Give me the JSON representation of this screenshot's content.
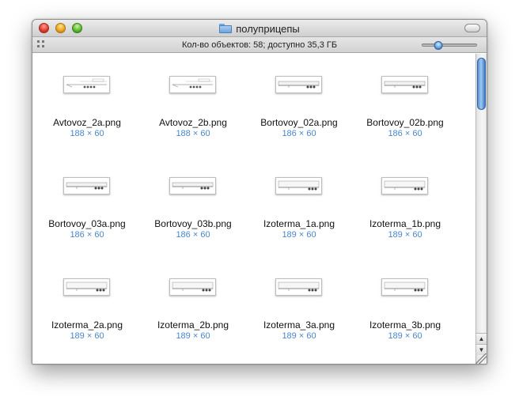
{
  "window": {
    "title": "полуприцепы",
    "folder_icon": "folder-icon"
  },
  "statusbar": {
    "text": "Кол-во объектов: 58; доступно 35,3 ГБ",
    "icon_size_slider_value": 0.3
  },
  "files": [
    {
      "name": "Avtovoz_2a.png",
      "dimensions": "188 × 60",
      "thumb": "car-carrier"
    },
    {
      "name": "Avtovoz_2b.png",
      "dimensions": "188 × 60",
      "thumb": "car-carrier"
    },
    {
      "name": "Bortovoy_02a.png",
      "dimensions": "186 × 60",
      "thumb": "flatbed"
    },
    {
      "name": "Bortovoy_02b.png",
      "dimensions": "186 × 60",
      "thumb": "flatbed"
    },
    {
      "name": "Bortovoy_03a.png",
      "dimensions": "186 × 60",
      "thumb": "flatbed"
    },
    {
      "name": "Bortovoy_03b.png",
      "dimensions": "186 × 60",
      "thumb": "flatbed"
    },
    {
      "name": "Izoterma_1a.png",
      "dimensions": "189 × 60",
      "thumb": "box-trailer"
    },
    {
      "name": "Izoterma_1b.png",
      "dimensions": "189 × 60",
      "thumb": "box-trailer"
    },
    {
      "name": "Izoterma_2a.png",
      "dimensions": "189 × 60",
      "thumb": "box-trailer"
    },
    {
      "name": "Izoterma_2b.png",
      "dimensions": "189 × 60",
      "thumb": "box-trailer"
    },
    {
      "name": "Izoterma_3a.png",
      "dimensions": "189 × 60",
      "thumb": "box-trailer"
    },
    {
      "name": "Izoterma_3b.png",
      "dimensions": "189 × 60",
      "thumb": "box-trailer"
    }
  ],
  "scrollbar": {
    "up_glyph": "▲",
    "down_glyph": "▼"
  }
}
